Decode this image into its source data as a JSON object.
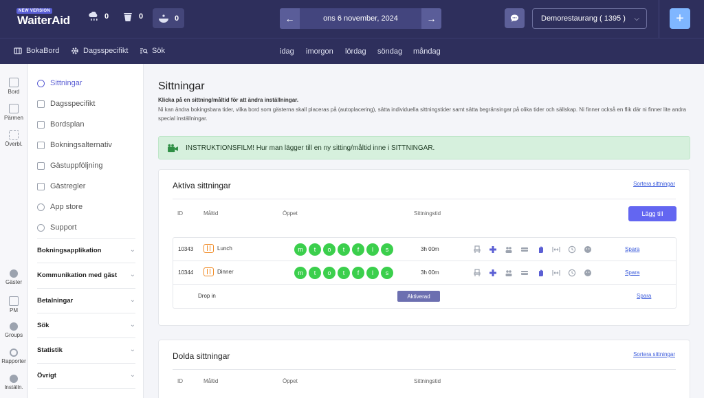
{
  "header": {
    "logo_badge": "NEW VERSION",
    "logo_text": "WaiterAid",
    "counters": [
      {
        "icon": "cloud-rain-icon",
        "value": "0"
      },
      {
        "icon": "coffee-cup-icon",
        "value": "0"
      },
      {
        "icon": "food-bowl-icon",
        "value": "0"
      }
    ],
    "date_prev": "←",
    "date_label": "ons 6 november, 2024",
    "date_next": "→",
    "chat_icon": "chat-bubble-icon",
    "restaurant": "Demorestaurang ( 1395 )",
    "plus": "+"
  },
  "subnav": {
    "items": [
      "BokaBord",
      "Dagsspecifikt",
      "Sök"
    ],
    "days": [
      "idag",
      "imorgon",
      "lördag",
      "söndag",
      "måndag"
    ]
  },
  "rail": [
    "Bord",
    "Pärmen",
    "Överbl.",
    "Gäster",
    "PM",
    "Groups",
    "Rapporter",
    "Inställn."
  ],
  "sidebar": {
    "items": [
      "Sittningar",
      "Dagsspecifikt",
      "Bordsplan",
      "Bokningsalternativ",
      "Gästuppföljning",
      "Gästregler",
      "App store",
      "Support"
    ],
    "groups": [
      "Bokningsapplikation",
      "Kommunikation med gäst",
      "Betalningar",
      "Sök",
      "Statistik",
      "Övrigt"
    ],
    "chevron": "⌄"
  },
  "main": {
    "title": "Sittningar",
    "subtitle": "Klicka på en sittning/måltid för att ändra inställningar.",
    "description": "Ni kan ändra bokingsbara tider, vilka bord som gästerna skall placeras på (autoplacering), sätta individuella sittningstider samt sätta begränsingar på olika tider och sällskap. Ni finner också en flik där ni finner lite andra special inställningar.",
    "alert": "INSTRUKTIONSFILM! Hur man lägger till en ny sitting/måltid inne i SITTNINGAR."
  },
  "active": {
    "title": "Aktiva sittningar",
    "sort_link": "Sortera sittningar",
    "columns": [
      "ID",
      "Måltid",
      "Öppet",
      "Sittningstid"
    ],
    "add_button": "Lägg till",
    "rows": [
      {
        "id": "10343",
        "meal": "Lunch",
        "days": [
          "m",
          "t",
          "o",
          "t",
          "f",
          "l",
          "s"
        ],
        "time": "3h 00m",
        "save": "Spara"
      },
      {
        "id": "10344",
        "meal": "Dinner",
        "days": [
          "m",
          "t",
          "o",
          "t",
          "f",
          "l",
          "s"
        ],
        "time": "3h 00m",
        "save": "Spara"
      }
    ],
    "dropin": {
      "label": "Drop in",
      "status": "Aktiverad",
      "save": "Spara"
    }
  },
  "hidden": {
    "title": "Dolda sittningar",
    "sort_link": "Sortera sittningar",
    "columns": [
      "ID",
      "Måltid",
      "Öppet",
      "Sittningstid"
    ]
  },
  "colors": {
    "accent": "#6366f1",
    "header": "#2e2f5c",
    "green": "#3bcf4c",
    "orange": "#f08a24",
    "link": "#3b5bdb"
  }
}
